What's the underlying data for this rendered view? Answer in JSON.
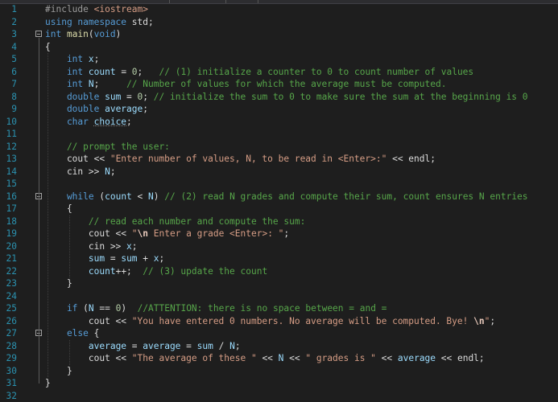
{
  "editor": {
    "lines": [
      {
        "n": "1",
        "tokens": [
          {
            "t": "#include ",
            "c": "pp"
          },
          {
            "t": "<iostream>",
            "c": "inc"
          }
        ]
      },
      {
        "n": "2",
        "tokens": [
          {
            "t": "using namespace ",
            "c": "kw"
          },
          {
            "t": "std;",
            "c": "pl"
          }
        ]
      },
      {
        "n": "3",
        "fold": "box",
        "tokens": [
          {
            "t": "int ",
            "c": "kw"
          },
          {
            "t": "main",
            "c": "fn"
          },
          {
            "t": "(",
            "c": "pl"
          },
          {
            "t": "void",
            "c": "kw"
          },
          {
            "t": ")",
            "c": "pl"
          }
        ]
      },
      {
        "n": "4",
        "tokens": [
          {
            "t": "{",
            "c": "pl"
          }
        ]
      },
      {
        "n": "5",
        "tokens": [
          {
            "t": "    int ",
            "c": "kw"
          },
          {
            "t": "x",
            "c": "var"
          },
          {
            "t": ";",
            "c": "pl"
          }
        ]
      },
      {
        "n": "6",
        "tokens": [
          {
            "t": "    int ",
            "c": "kw"
          },
          {
            "t": "count",
            "c": "var"
          },
          {
            "t": " = ",
            "c": "pl"
          },
          {
            "t": "0",
            "c": "num"
          },
          {
            "t": ";   ",
            "c": "pl"
          },
          {
            "t": "// (1) initialize a counter to 0 to count number of values",
            "c": "cm"
          }
        ]
      },
      {
        "n": "7",
        "tokens": [
          {
            "t": "    int ",
            "c": "kw"
          },
          {
            "t": "N",
            "c": "var"
          },
          {
            "t": ";     ",
            "c": "pl"
          },
          {
            "t": "// Number of values for which the average must be computed.",
            "c": "cm"
          }
        ]
      },
      {
        "n": "8",
        "tokens": [
          {
            "t": "    double ",
            "c": "kw"
          },
          {
            "t": "sum",
            "c": "var"
          },
          {
            "t": " = ",
            "c": "pl"
          },
          {
            "t": "0",
            "c": "num"
          },
          {
            "t": "; ",
            "c": "pl"
          },
          {
            "t": "// initialize the sum to 0 to make sure the sum at the beginning is 0",
            "c": "cm"
          }
        ]
      },
      {
        "n": "9",
        "tokens": [
          {
            "t": "    double ",
            "c": "kw"
          },
          {
            "t": "average",
            "c": "var"
          },
          {
            "t": ";",
            "c": "pl"
          }
        ]
      },
      {
        "n": "10",
        "tokens": [
          {
            "t": "    char ",
            "c": "kw"
          },
          {
            "t": "choice",
            "c": "var squiggle"
          },
          {
            "t": ";",
            "c": "pl"
          }
        ]
      },
      {
        "n": "11",
        "tokens": []
      },
      {
        "n": "12",
        "tokens": [
          {
            "t": "    // prompt the user:",
            "c": "cm"
          }
        ]
      },
      {
        "n": "13",
        "tokens": [
          {
            "t": "    cout << ",
            "c": "pl"
          },
          {
            "t": "\"Enter number of values, N, to be read in <Enter>:\"",
            "c": "str"
          },
          {
            "t": " << endl;",
            "c": "pl"
          }
        ]
      },
      {
        "n": "14",
        "tokens": [
          {
            "t": "    cin >> ",
            "c": "pl"
          },
          {
            "t": "N",
            "c": "var"
          },
          {
            "t": ";",
            "c": "pl"
          }
        ]
      },
      {
        "n": "15",
        "tokens": []
      },
      {
        "n": "16",
        "fold": "box",
        "tokens": [
          {
            "t": "    while ",
            "c": "kw"
          },
          {
            "t": "(",
            "c": "pl"
          },
          {
            "t": "count",
            "c": "var"
          },
          {
            "t": " < ",
            "c": "pl"
          },
          {
            "t": "N",
            "c": "var"
          },
          {
            "t": ") ",
            "c": "pl"
          },
          {
            "t": "// (2) read N grades and compute their sum, count ensures N entries",
            "c": "cm"
          }
        ]
      },
      {
        "n": "17",
        "tokens": [
          {
            "t": "    {",
            "c": "pl"
          }
        ]
      },
      {
        "n": "18",
        "tokens": [
          {
            "t": "        // read each number and compute the sum:",
            "c": "cm"
          }
        ]
      },
      {
        "n": "19",
        "tokens": [
          {
            "t": "        cout << ",
            "c": "pl"
          },
          {
            "t": "\"",
            "c": "str"
          },
          {
            "t": "\\n",
            "c": "esc"
          },
          {
            "t": " Enter a grade <Enter>: \"",
            "c": "str"
          },
          {
            "t": ";",
            "c": "pl"
          }
        ]
      },
      {
        "n": "20",
        "tokens": [
          {
            "t": "        cin >> ",
            "c": "pl"
          },
          {
            "t": "x",
            "c": "var"
          },
          {
            "t": ";",
            "c": "pl"
          }
        ]
      },
      {
        "n": "21",
        "tokens": [
          {
            "t": "        ",
            "c": "pl"
          },
          {
            "t": "sum",
            "c": "var"
          },
          {
            "t": " = ",
            "c": "pl"
          },
          {
            "t": "sum",
            "c": "var"
          },
          {
            "t": " + ",
            "c": "pl"
          },
          {
            "t": "x",
            "c": "var"
          },
          {
            "t": ";",
            "c": "pl"
          }
        ]
      },
      {
        "n": "22",
        "tokens": [
          {
            "t": "        ",
            "c": "pl"
          },
          {
            "t": "count",
            "c": "var"
          },
          {
            "t": "++;  ",
            "c": "pl"
          },
          {
            "t": "// (3) update the count",
            "c": "cm"
          }
        ]
      },
      {
        "n": "23",
        "tokens": [
          {
            "t": "    }",
            "c": "pl"
          }
        ]
      },
      {
        "n": "24",
        "tokens": []
      },
      {
        "n": "25",
        "tokens": [
          {
            "t": "    if ",
            "c": "kw"
          },
          {
            "t": "(",
            "c": "pl"
          },
          {
            "t": "N",
            "c": "var"
          },
          {
            "t": " == ",
            "c": "pl"
          },
          {
            "t": "0",
            "c": "num"
          },
          {
            "t": ")  ",
            "c": "pl"
          },
          {
            "t": "//ATTENTION: there is no space between = and =",
            "c": "cm"
          }
        ]
      },
      {
        "n": "26",
        "tokens": [
          {
            "t": "        cout << ",
            "c": "pl"
          },
          {
            "t": "\"You have entered 0 numbers. No average will be computed. Bye! ",
            "c": "str"
          },
          {
            "t": "\\n",
            "c": "esc"
          },
          {
            "t": "\"",
            "c": "str"
          },
          {
            "t": ";",
            "c": "pl"
          }
        ]
      },
      {
        "n": "27",
        "fold": "box",
        "tokens": [
          {
            "t": "    else ",
            "c": "kw"
          },
          {
            "t": "{",
            "c": "pl"
          }
        ]
      },
      {
        "n": "28",
        "tokens": [
          {
            "t": "        ",
            "c": "pl"
          },
          {
            "t": "average",
            "c": "var"
          },
          {
            "t": " = ",
            "c": "pl"
          },
          {
            "t": "average",
            "c": "var"
          },
          {
            "t": " = ",
            "c": "pl"
          },
          {
            "t": "sum",
            "c": "var"
          },
          {
            "t": " / ",
            "c": "pl"
          },
          {
            "t": "N",
            "c": "var"
          },
          {
            "t": ";",
            "c": "pl"
          }
        ]
      },
      {
        "n": "29",
        "tokens": [
          {
            "t": "        cout << ",
            "c": "pl"
          },
          {
            "t": "\"The average of these \"",
            "c": "str"
          },
          {
            "t": " << ",
            "c": "pl"
          },
          {
            "t": "N",
            "c": "var"
          },
          {
            "t": " << ",
            "c": "pl"
          },
          {
            "t": "\" grades is \"",
            "c": "str"
          },
          {
            "t": " << ",
            "c": "pl"
          },
          {
            "t": "average",
            "c": "var"
          },
          {
            "t": " << endl;",
            "c": "pl"
          }
        ]
      },
      {
        "n": "30",
        "tokens": [
          {
            "t": "    }",
            "c": "pl"
          }
        ]
      },
      {
        "n": "31",
        "tokens": [
          {
            "t": "}",
            "c": "pl"
          }
        ]
      },
      {
        "n": "32",
        "tokens": []
      }
    ]
  }
}
